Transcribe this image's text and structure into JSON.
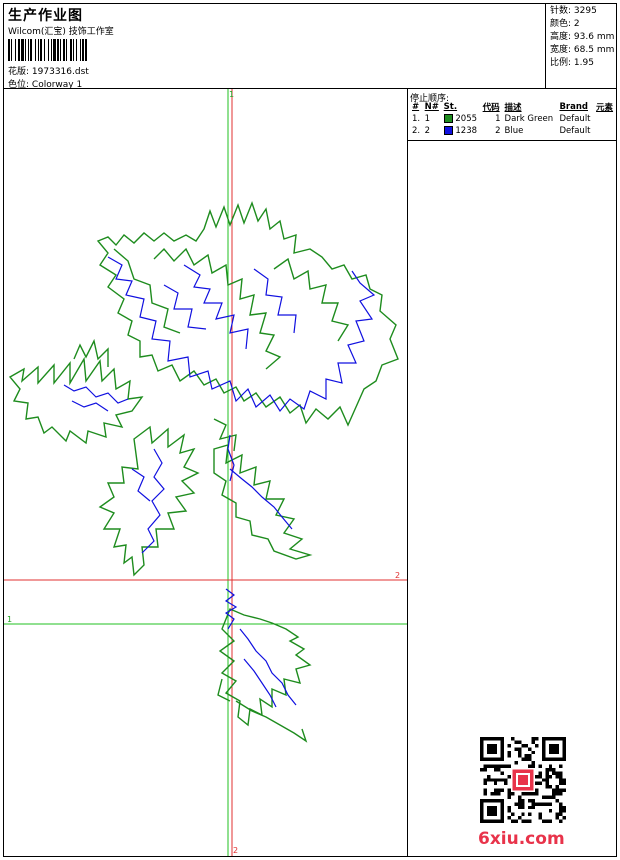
{
  "header": {
    "title": "生产作业图",
    "company": "Wilcom(汇宝) 技饰工作室",
    "pattern_label": "花版:",
    "pattern_value": "1973316.dst",
    "colorway_label": "色位:",
    "colorway_value": "Colorway 1"
  },
  "stats": [
    {
      "label": "针数:",
      "value": "3295"
    },
    {
      "label": "颜色:",
      "value": "2"
    },
    {
      "label": "高度:",
      "value": "93.6 mm"
    },
    {
      "label": "宽度:",
      "value": "68.5 mm"
    },
    {
      "label": "比例:",
      "value": "1.95"
    }
  ],
  "stop_sequence": {
    "title": "停止顺序:",
    "headers": [
      "#",
      "N#",
      "St.",
      "代码",
      "描述",
      "Brand",
      "元素"
    ],
    "rows": [
      {
        "index": "1.",
        "n": "1",
        "color": "#1e8c1e",
        "stitches": "2055",
        "code": "1",
        "description": "Dark Green",
        "brand": "Default"
      },
      {
        "index": "2.",
        "n": "2",
        "color": "#1010e0",
        "stitches": "1238",
        "code": "2",
        "description": "Blue",
        "brand": "Default"
      }
    ]
  },
  "guides": {
    "top_marker": "1",
    "bottom_marker": "2",
    "left_marker": "1",
    "right_marker": "2"
  },
  "colors": {
    "green": "#1e8c1e",
    "blue": "#1010e0",
    "guide_green": "#22c022",
    "guide_red": "#e03030",
    "watermark": "#e8334a"
  },
  "watermark": "6xiu.com"
}
